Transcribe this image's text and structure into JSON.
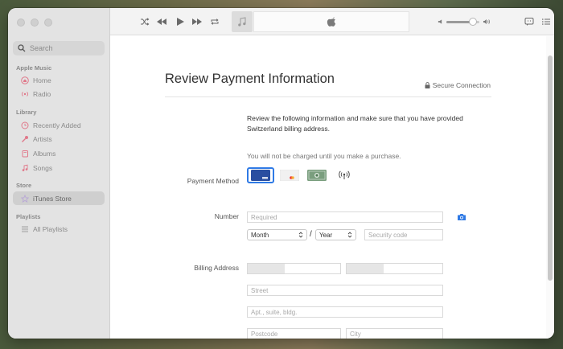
{
  "sidebar": {
    "search": {
      "placeholder": "Search"
    },
    "sections": [
      {
        "label": "Apple Music",
        "items": [
          {
            "label": "Home",
            "icon": "home-icon"
          },
          {
            "label": "Radio",
            "icon": "radio-icon"
          }
        ]
      },
      {
        "label": "Library",
        "items": [
          {
            "label": "Recently Added",
            "icon": "clock-icon"
          },
          {
            "label": "Artists",
            "icon": "microphone-icon"
          },
          {
            "label": "Albums",
            "icon": "album-icon"
          },
          {
            "label": "Songs",
            "icon": "music-note-icon"
          }
        ]
      },
      {
        "label": "Store",
        "items": [
          {
            "label": "iTunes Store",
            "icon": "star-icon",
            "active": true
          }
        ]
      },
      {
        "label": "Playlists",
        "items": [
          {
            "label": "All Playlists",
            "icon": "grid-icon"
          }
        ]
      }
    ]
  },
  "toolbar": {
    "volume_level": 0.8,
    "icons": [
      "shuffle-icon",
      "rewind-icon",
      "play-icon",
      "fast-forward-icon",
      "repeat-icon",
      "music-note-icon",
      "apple-logo-icon",
      "speaker-low-icon",
      "speaker-high-icon",
      "lyrics-icon",
      "queue-icon"
    ]
  },
  "page": {
    "title": "Review Payment Information",
    "secure": "Secure Connection",
    "instructions": "Review the following information and make sure that you have provided Switzerland billing address.",
    "note": "You will not be charged until you make a purchase.",
    "payment_method_label": "Payment Method",
    "payment_methods": [
      "visa-card-icon",
      "mastercard-icon",
      "amex-card-icon",
      "contactless-icon"
    ],
    "number_label": "Number",
    "number_placeholder": "Required",
    "month_label": "Month",
    "year_label": "Year",
    "date_separator": "/",
    "security_placeholder": "Security code",
    "billing_label": "Billing Address",
    "street_placeholder": "Street",
    "apt_placeholder": "Apt., suite, bldg.",
    "postcode_placeholder": "Postcode",
    "city_placeholder": "City"
  },
  "colors": {
    "accent": "#2f7ae5",
    "sidebar_bg": "#e3e3e3"
  }
}
